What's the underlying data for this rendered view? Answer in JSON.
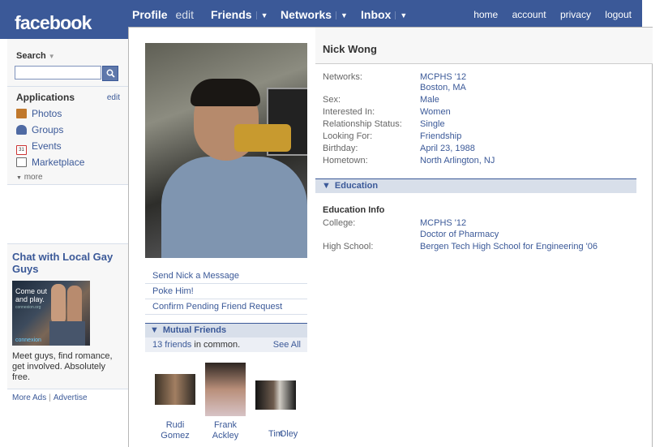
{
  "topbar": {
    "logo": "facebook",
    "profile": "Profile",
    "edit": "edit",
    "friends": "Friends",
    "networks": "Networks",
    "inbox": "Inbox",
    "caret": "▼",
    "links": [
      "home",
      "account",
      "privacy",
      "logout"
    ]
  },
  "sidebar": {
    "search_label": "Search",
    "search_caret": "▼",
    "applications_title": "Applications",
    "applications_edit": "edit",
    "apps": [
      {
        "label": "Photos",
        "icon": "photos-icon",
        "color": "#c0782c"
      },
      {
        "label": "Groups",
        "icon": "groups-icon",
        "color": "#4f6aa3"
      },
      {
        "label": "Events",
        "icon": "events-icon",
        "color": "#cc3333"
      },
      {
        "label": "Marketplace",
        "icon": "marketplace-icon",
        "color": "#6a6a6a"
      }
    ],
    "more": "more",
    "ad": {
      "title": "Chat with Local Gay Guys",
      "image_text": "Come out and play.",
      "image_url_text": "connexion.org",
      "image_logo": "connexion",
      "text": "Meet guys, find romance, get involved. Absolutely free."
    },
    "more_ads": "More Ads",
    "advertise": "Advertise"
  },
  "profile": {
    "name": "Nick Wong",
    "actions": [
      "Send Nick a Message",
      "Poke Him!",
      "Confirm Pending Friend Request"
    ],
    "mutual_friends": {
      "header": "Mutual Friends",
      "count_link": "13 friends",
      "count_suffix": " in common.",
      "see_all": "See All",
      "friends": [
        {
          "first": "Rudi",
          "last": "Gomez"
        },
        {
          "first": "Frank",
          "last": "Ackley"
        },
        {
          "first": "Tim",
          "last": "Oley"
        }
      ]
    },
    "info": {
      "networks_label": "Networks:",
      "networks_value1": "MCPHS '12",
      "networks_value2": "Boston, MA",
      "sex_label": "Sex:",
      "sex_value": "Male",
      "interested_label": "Interested In:",
      "interested_value": "Women",
      "relationship_label": "Relationship Status:",
      "relationship_value": "Single",
      "looking_label": "Looking For:",
      "looking_value": "Friendship",
      "birthday_label": "Birthday:",
      "birthday_value": "April 23, 1988",
      "hometown_label": "Hometown:",
      "hometown_value": "North Arlington, NJ"
    },
    "education": {
      "header": "Education",
      "title": "Education Info",
      "college_label": "College:",
      "college_value1": "MCPHS '12",
      "college_value2": "Doctor of Pharmacy",
      "highschool_label": "High School:",
      "highschool_value": "Bergen Tech High School for Engineering '06"
    }
  },
  "colors": {
    "brand": "#3b5998",
    "header_bg": "#d8dfea",
    "sidebar_bg": "#f7f7f7"
  }
}
